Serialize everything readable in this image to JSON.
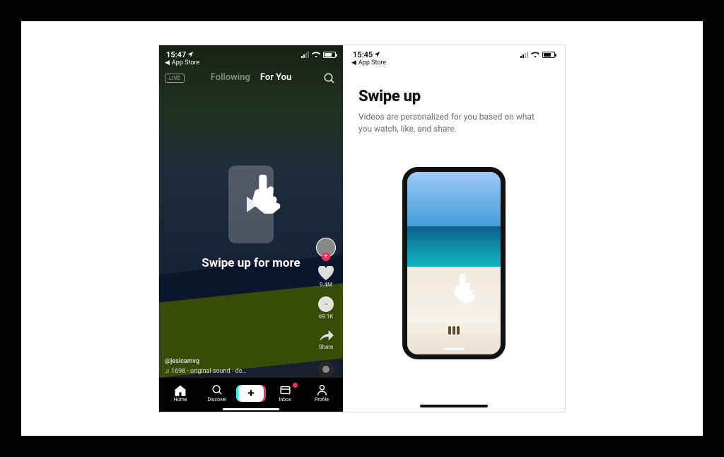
{
  "left": {
    "status": {
      "time": "15:47",
      "back_label": "App Store"
    },
    "tabs": {
      "following": "Following",
      "for_you": "For You"
    },
    "hint": "Swipe up for more",
    "rail": {
      "likes": "9.4M",
      "comments": "69.1K",
      "share": "Share"
    },
    "caption": {
      "user": "@jesicamvg",
      "sound": "♫  1698 · original sound - de…"
    },
    "nav": {
      "home": "Home",
      "discover": "Discover",
      "inbox": "Inbox",
      "profile": "Profile"
    }
  },
  "right": {
    "status": {
      "time": "15:45",
      "back_label": "App Store"
    },
    "title": "Swipe up",
    "subtitle": "Videos are personalized for you based on what you watch, like, and share."
  }
}
